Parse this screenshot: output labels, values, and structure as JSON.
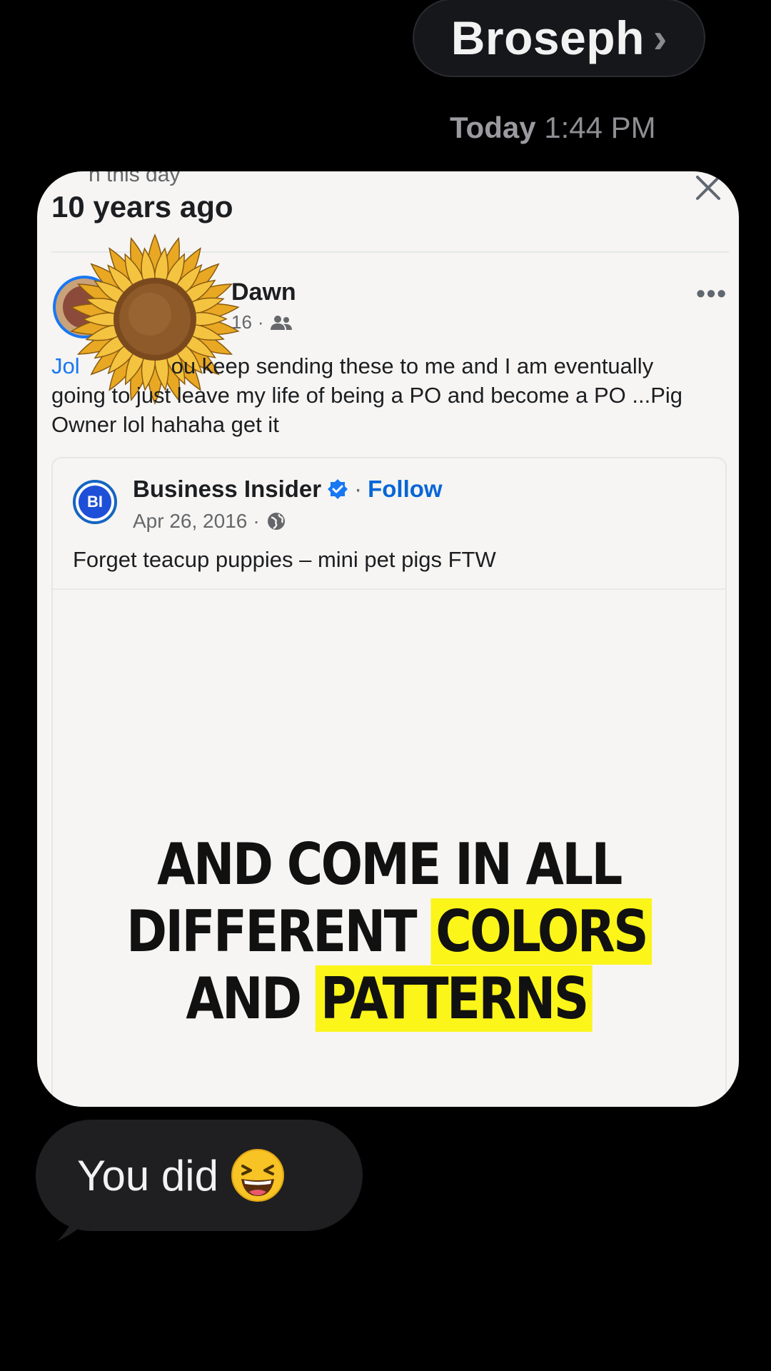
{
  "contact": {
    "name": "Broseph",
    "chevron": "›"
  },
  "timestamp": {
    "day": "Today",
    "time": "1:44 PM"
  },
  "shared_post": {
    "memory_label": "n this day",
    "memory_title": "10 years ago",
    "close_icon": "close-icon",
    "poster": {
      "name": "Dawn",
      "date_partial": "16",
      "privacy_icon": "friends-icon"
    },
    "more_icon": "•••",
    "text_mention": "Jol",
    "text_body": "ou keep sending these to me and I am eventually going to just leave my life of being a PO and become a PO ...Pig Owner lol hahaha get it",
    "sticker": "sunflower-sticker",
    "shared": {
      "logo_text": "BI",
      "source_name": "Business Insider",
      "follow_label": "Follow",
      "separator": "·",
      "date": "Apr 26, 2016",
      "caption": "Forget teacup puppies – mini pet pigs FTW",
      "video_caption": {
        "line1": "AND COME IN ALL",
        "line2_plain": "DIFFERENT",
        "line2_highlight": "COLORS",
        "line3_plain": "AND",
        "line3_highlight": "PATTERNS",
        "highlight_color": "#fbf51a"
      }
    }
  },
  "reply": {
    "text": "You did",
    "emoji": "😆"
  },
  "colors": {
    "background": "#000000",
    "bubble_incoming": "#1f1f21",
    "link_blue": "#1877f2",
    "follow_blue": "#0866d6"
  }
}
